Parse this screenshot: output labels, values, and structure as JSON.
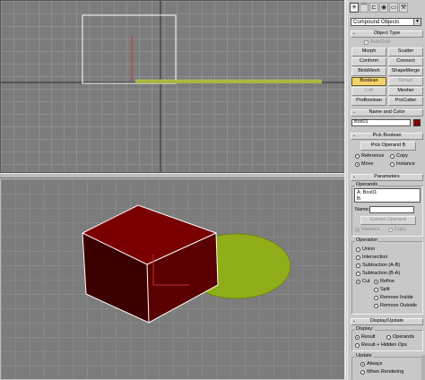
{
  "command_panel": {
    "tabs": [
      "create-icon",
      "modify-icon",
      "hierarchy-icon",
      "motion-icon",
      "display-icon",
      "utilities-icon"
    ],
    "category_dropdown": "Compound Objects",
    "object_type": {
      "title": "Object Type",
      "autogrid_label": "AutoGrid",
      "buttons": [
        "Morph",
        "Scatter",
        "Conform",
        "Connect",
        "BlobMesh",
        "ShapeMerge",
        "Boolean",
        "Terrain",
        "Loft",
        "Mesher",
        "ProBoolean",
        "ProCutter"
      ],
      "active_button": "Boolean"
    },
    "name_and_color": {
      "title": "Name and Color",
      "name_value": "Box01",
      "color": "#8b0000"
    },
    "pick_boolean": {
      "title": "Pick Boolean",
      "pick_button": "Pick Operand B",
      "options": [
        "Reference",
        "Copy",
        "Move",
        "Instance"
      ],
      "selected": "Move"
    },
    "parameters": {
      "title": "Parameters",
      "operands_label": "Operands",
      "operands": [
        "A: Box01",
        "B:"
      ],
      "name_label": "Name:",
      "extract_button": "Extract Operand",
      "extract_options": [
        "Instance",
        "Copy"
      ],
      "operation_label": "Operation",
      "operations": [
        "Union",
        "Intersection",
        "Subtraction (A-B)",
        "Subtraction (B-A)",
        "Cut"
      ],
      "selected_operation": "Cut",
      "cut_options": [
        "Refine",
        "Split",
        "Remove Inside",
        "Remove Outside"
      ],
      "selected_cut_option": "Refine"
    },
    "display_update": {
      "title": "Display/Update",
      "display_label": "Display:",
      "display_options": [
        "Result",
        "Operands",
        "Result + Hidden Ops"
      ],
      "selected_display": "Result",
      "update_label": "Update",
      "update_options": [
        "Always",
        "When Rendering"
      ],
      "selected_update": "Always"
    }
  },
  "colors": {
    "box": "#7a0000",
    "cylinder": "#8fae1a",
    "selection": "#ffffff",
    "active_button": "#f3d26a"
  }
}
